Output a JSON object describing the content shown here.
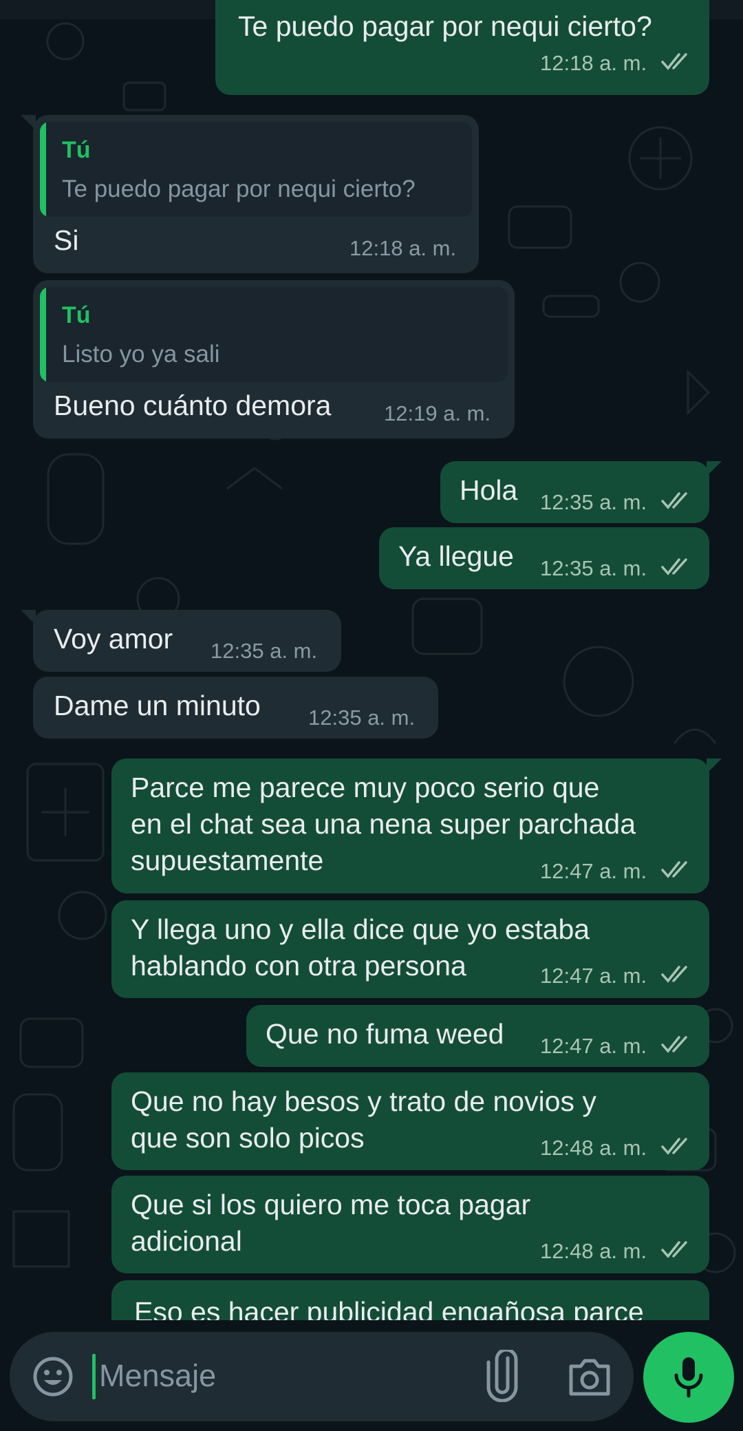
{
  "colors": {
    "background": "#0b141a",
    "outgoing_bubble": "#144d37",
    "incoming_bubble": "#1f2c34",
    "accent": "#21c063",
    "read_ticks": "#a9c4b7"
  },
  "messages": [
    {
      "direction": "out",
      "text": "Te puedo pagar por nequi cierto?",
      "time": "12:18 a. m.",
      "status": "read"
    },
    {
      "direction": "in",
      "reply_to": {
        "author": "Tú",
        "text": "Te puedo pagar por nequi cierto?"
      },
      "text": "Si",
      "time": "12:18 a. m."
    },
    {
      "direction": "in",
      "reply_to": {
        "author": "Tú",
        "text": "Listo yo ya sali"
      },
      "text": "Bueno cuánto demora",
      "time": "12:19 a. m."
    },
    {
      "direction": "out",
      "text": "Hola",
      "time": "12:35 a. m.",
      "status": "read"
    },
    {
      "direction": "out",
      "text": "Ya llegue",
      "time": "12:35 a. m.",
      "status": "read"
    },
    {
      "direction": "in",
      "text": "Voy amor",
      "time": "12:35 a. m."
    },
    {
      "direction": "in",
      "text": "Dame un minuto",
      "time": "12:35 a. m."
    },
    {
      "direction": "out",
      "text": "Parce me parece muy poco serio que\nen el chat sea una nena super parchada\nsupuestamente",
      "time": "12:47 a. m.",
      "status": "read"
    },
    {
      "direction": "out",
      "text": "Y llega uno y ella dice que yo estaba\nhablando con otra persona",
      "time": "12:47 a. m.",
      "status": "read"
    },
    {
      "direction": "out",
      "text": "Que no fuma weed",
      "time": "12:47 a. m.",
      "status": "read"
    },
    {
      "direction": "out",
      "text": "Que no hay besos y trato de novios y\nque son solo picos",
      "time": "12:48 a. m.",
      "status": "read"
    },
    {
      "direction": "out",
      "text": "Que si los quiero me toca pagar\nadicional",
      "time": "12:48 a. m.",
      "status": "read"
    },
    {
      "direction": "out",
      "text": "Eso es hacer publicidad engañosa parce",
      "time": "",
      "status": ""
    }
  ],
  "composer": {
    "placeholder": "Mensaje",
    "emoji_icon": "emoji-icon",
    "attach_icon": "paperclip-icon",
    "camera_icon": "camera-icon",
    "mic_icon": "microphone-icon"
  }
}
